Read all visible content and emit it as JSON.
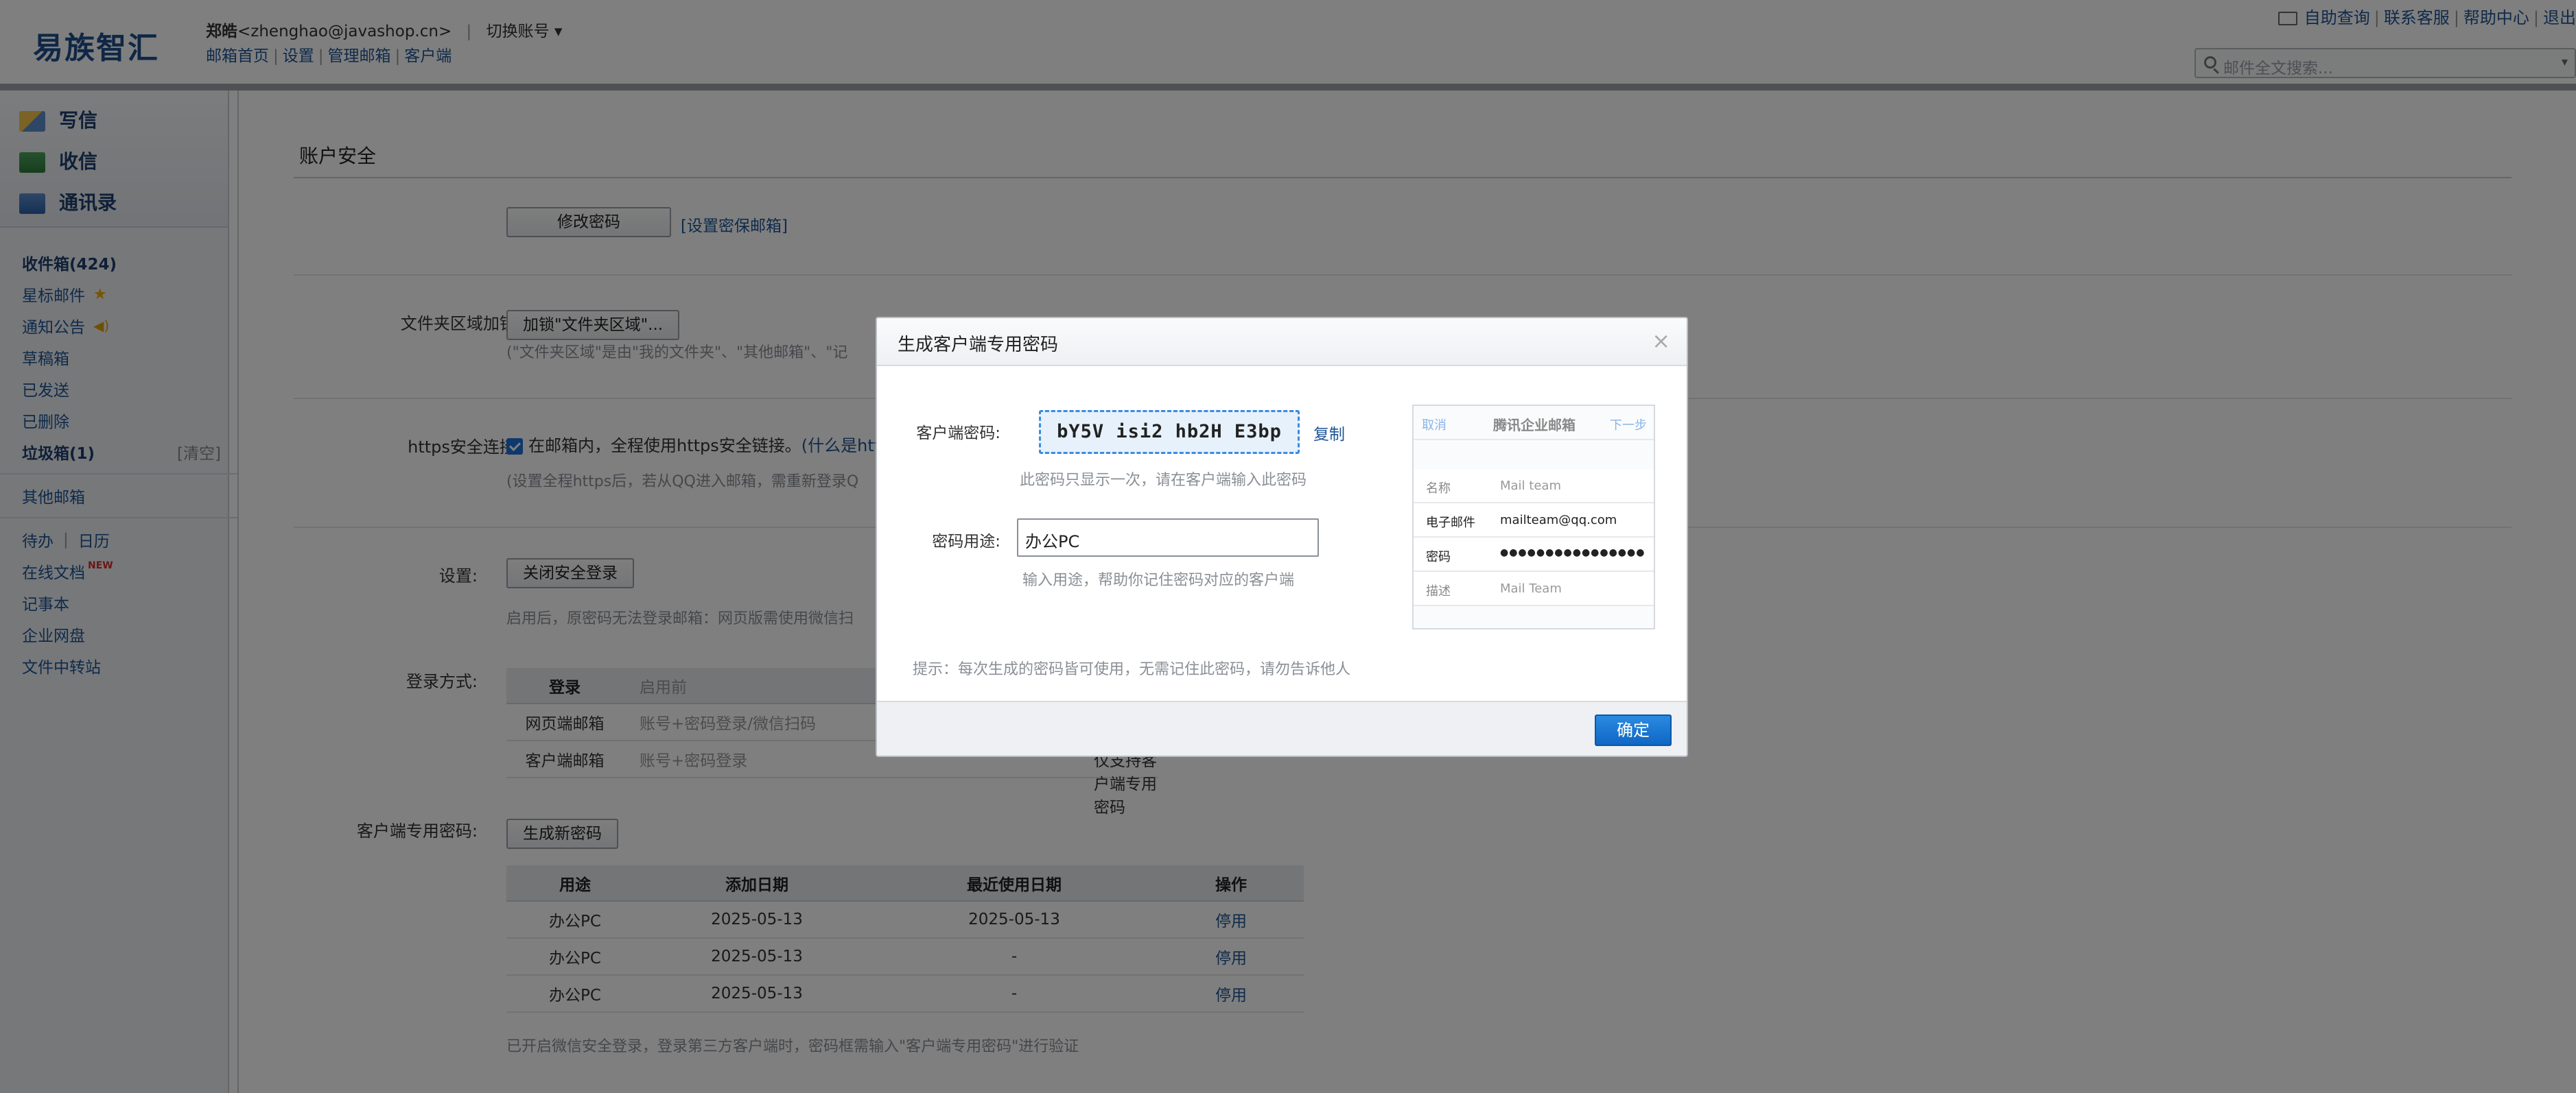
{
  "header": {
    "logo": "易族智汇",
    "user_name": "郑皓",
    "user_email": "<zhenghao@javashop.cn>",
    "switch_account": "切换账号",
    "nav": [
      "邮箱首页",
      "设置",
      "管理邮箱",
      "客户端"
    ],
    "right_links": [
      "自助查询",
      "联系客服",
      "帮助中心",
      "退出"
    ],
    "search_placeholder": "邮件全文搜索..."
  },
  "sidebar": {
    "compose": [
      "写信",
      "收信",
      "通讯录"
    ],
    "folders_main": [
      {
        "label": "收件箱(424)",
        "bold": true
      },
      {
        "label": "星标邮件",
        "icon": "star-icon"
      },
      {
        "label": "通知公告",
        "icon": "speaker-icon"
      },
      {
        "label": "草稿箱"
      },
      {
        "label": "已发送"
      },
      {
        "label": "已删除"
      },
      {
        "label": "垃圾箱(1)",
        "bold": true,
        "extra": "[清空]"
      }
    ],
    "other_mailbox": "其他邮箱",
    "todo": "待办",
    "calendar": "日历",
    "tools": [
      {
        "label": "在线文档",
        "badge": "NEW"
      },
      {
        "label": "记事本"
      },
      {
        "label": "企业网盘"
      },
      {
        "label": "文件中转站"
      }
    ]
  },
  "main": {
    "section_title": "账户安全",
    "change_password_btn": "修改密码",
    "security_mail_link": "[设置密保邮箱]",
    "folder_lock_label": "文件夹区域加锁:",
    "folder_lock_btn": "加锁\"文件夹区域\"...",
    "folder_lock_note": "(\"文件夹区域\"是由\"我的文件夹\"、\"其他邮箱\"、\"记",
    "https_label": "https安全连接:",
    "https_text": "在邮箱内，全程使用https安全链接。",
    "https_link": "(什么是http",
    "https_note": "(设置全程https后，若从QQ进入邮箱，需重新登录Q",
    "settings_label": "设置:",
    "secure_login_btn": "关闭安全登录",
    "secure_login_note": "启用后，原密码无法登录邮箱：网页版需使用微信扫",
    "login_method_label": "登录方式:",
    "login_table": {
      "headers": [
        "登录",
        "启用前"
      ],
      "rows": [
        [
          "网页端邮箱",
          "账号+密码登录/微信扫码"
        ],
        [
          "客户端邮箱",
          "账号+密码登录"
        ]
      ],
      "row2_after": "仅支持客户端专用密码"
    },
    "client_pw_label": "客户端专用密码:",
    "generate_btn": "生成新密码",
    "pw_table": {
      "headers": [
        "用途",
        "添加日期",
        "最近使用日期",
        "操作"
      ],
      "rows": [
        [
          "办公PC",
          "2025-05-13",
          "2025-05-13",
          "停用"
        ],
        [
          "办公PC",
          "2025-05-13",
          "-",
          "停用"
        ],
        [
          "办公PC",
          "2025-05-13",
          "-",
          "停用"
        ]
      ]
    },
    "footer_note": "已开启微信安全登录，登录第三方客户端时，密码框需输入\"客户端专用密码\"进行验证"
  },
  "modal": {
    "title": "生成客户端专用密码",
    "close": "×",
    "password_label": "客户端密码:",
    "password_value": "bY5V isi2 hb2H E3bp",
    "copy": "复制",
    "password_hint": "此密码只显示一次，请在客户端输入此密码",
    "usage_label": "密码用途:",
    "usage_value": "办公PC",
    "usage_hint": "输入用途，帮助你记住密码对应的客户端",
    "tip": "提示：每次生成的密码皆可使用，无需记住此密码，请勿告诉他人",
    "ok": "确定",
    "preview": {
      "cancel": "取消",
      "title": "腾讯企业邮箱",
      "next": "下一步",
      "rows": [
        {
          "k": "名称",
          "v": "Mail team"
        },
        {
          "k": "电子邮件",
          "v": "mailteam@qq.com"
        },
        {
          "k": "密码",
          "v": "●●●●●●●●●●●●●●●●"
        },
        {
          "k": "描述",
          "v": "Mail Team"
        }
      ]
    }
  }
}
